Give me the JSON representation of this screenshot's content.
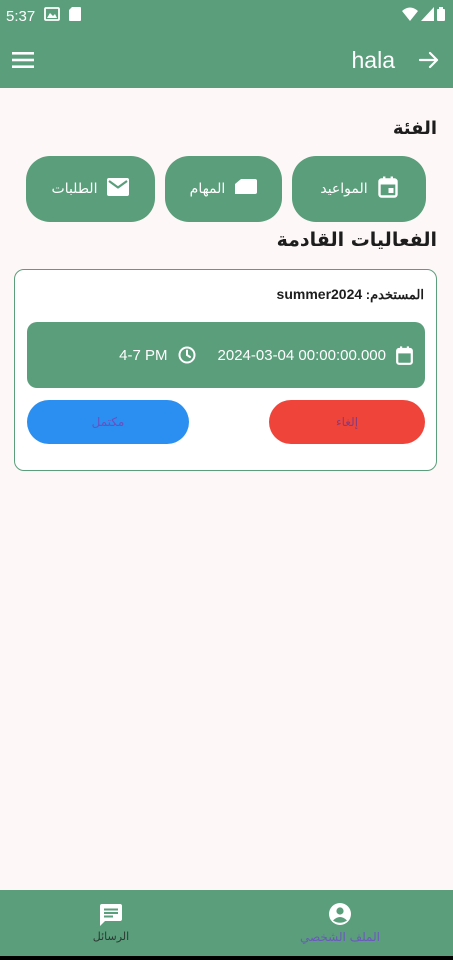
{
  "status_bar": {
    "time": "5:37"
  },
  "app_bar": {
    "title": "hala"
  },
  "categories": {
    "heading": "الفئة",
    "items": [
      {
        "label": "المواعيد",
        "icon": "calendar-icon"
      },
      {
        "label": "المهام",
        "icon": "label-icon"
      },
      {
        "label": "الطلبات",
        "icon": "mail-icon"
      }
    ]
  },
  "events": {
    "heading": "الفعاليات القادمة",
    "card": {
      "user_label": "المستخدم:",
      "username": "summer2024",
      "datetime": "2024-03-04 00:00:00.000",
      "time_range": "4-7 PM",
      "cancel_label": "إلغاء",
      "complete_label": "مكتمل"
    }
  },
  "bottom_nav": {
    "messages_label": "الرسائل",
    "profile_label": "الملف الشخصي"
  },
  "colors": {
    "primary": "#5b9e7b",
    "background": "#fdf8f7",
    "cancel": "#ef443a",
    "complete": "#2a8ff0",
    "active_nav_label": "#6b59bd"
  }
}
